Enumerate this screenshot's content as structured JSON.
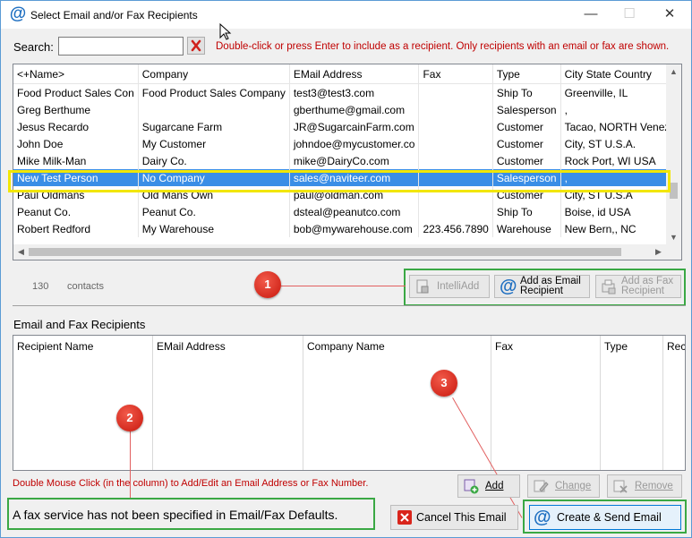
{
  "window": {
    "title": "Select Email and/or Fax Recipients",
    "app_icon": "@",
    "controls": {
      "minimize": "—",
      "maximize": "☐",
      "close": "✕"
    }
  },
  "search": {
    "label": "Search:",
    "value": "",
    "clear_icon": "red-x-icon",
    "hint": "Double-click or press Enter to include as a recipient.  Only recipients with an email or fax are shown."
  },
  "contacts_grid": {
    "columns": [
      "<+Name>",
      "Company",
      "EMail Address",
      "Fax",
      "Type",
      "City State Country"
    ],
    "rows": [
      [
        "Food Product Sales Con",
        "Food Product Sales Company",
        "test3@test3.com",
        "",
        "Ship To",
        "Greenville, IL"
      ],
      [
        "Greg Berthume",
        "",
        "gberthume@gmail.com",
        "",
        "Salesperson",
        ","
      ],
      [
        "Jesus Recardo",
        "Sugarcane Farm",
        "JR@SugarcainFarm.com",
        "",
        "Customer",
        "Tacao, NORTH Venezuela"
      ],
      [
        "John Doe",
        "My Customer",
        "johndoe@mycustomer.co",
        "",
        "Customer",
        "City, ST U.S.A."
      ],
      [
        "Mike Milk-Man",
        "Dairy Co.",
        "mike@DairyCo.com",
        "",
        "Customer",
        "Rock Port, WI USA"
      ],
      [
        "New Test Person",
        "No Company",
        "sales@naviteer.com",
        "",
        "Salesperson",
        ","
      ],
      [
        "Paul Oldmans",
        "Old Mans Own",
        "paul@oldman.com",
        "",
        "Customer",
        "City, ST U.S.A"
      ],
      [
        "Peanut Co.",
        "Peanut Co.",
        "dsteal@peanutco.com",
        "",
        "Ship To",
        "Boise, id USA"
      ],
      [
        "Robert Redford",
        "My Warehouse",
        "bob@mywarehouse.com",
        "223.456.7890",
        "Warehouse",
        "New Bern,, NC"
      ]
    ],
    "selected_index": 5
  },
  "contact_count": {
    "number": "130",
    "label": "contacts"
  },
  "toolbar": {
    "intelliadd": "IntelliAdd",
    "add_email_line1": "Add as Email",
    "add_email_line2": "Recipient",
    "add_fax_line1": "Add as Fax",
    "add_fax_line2": "Recipient"
  },
  "recipients": {
    "title": "Email and Fax Recipients",
    "columns": [
      "Recipient Name",
      "EMail Address",
      "Company Name",
      "Fax",
      "Type",
      "Rec"
    ]
  },
  "double_click_hint": "Double Mouse Click (in the column) to Add/Edit an Email Address or Fax Number.",
  "recipient_buttons": {
    "add": "Add",
    "change": "Change",
    "remove": "Remove"
  },
  "status_message": "A fax service has not been specified in Email/Fax Defaults.",
  "footer_buttons": {
    "cancel": "Cancel This Email",
    "create_send": "Create & Send Email"
  },
  "callouts": [
    "1",
    "2",
    "3"
  ],
  "colors": {
    "accent": "#1e6fc1",
    "selection": "#3a8ee6",
    "hint_red": "#c00000",
    "callout_red": "#d9251b",
    "highlight_green": "#3aa844",
    "highlight_yellow": "#f2e600"
  }
}
